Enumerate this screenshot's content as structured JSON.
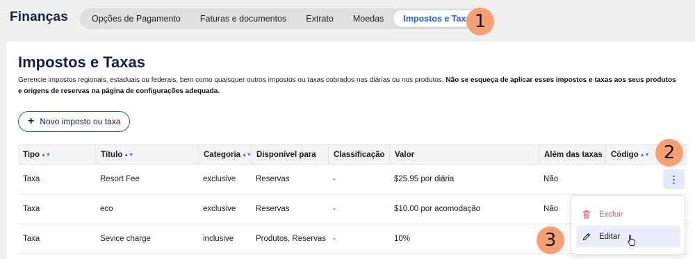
{
  "app": {
    "title": "Finanças"
  },
  "tabs": [
    {
      "label": "Opções de Pagamento",
      "active": false
    },
    {
      "label": "Faturas e documentos",
      "active": false
    },
    {
      "label": "Extrato",
      "active": false
    },
    {
      "label": "Moedas",
      "active": false
    },
    {
      "label": "Impostos e Taxas",
      "active": true
    }
  ],
  "callouts": {
    "one": "1",
    "two": "2",
    "three": "3"
  },
  "page": {
    "title": "Impostos e Taxas",
    "description": "Gerencie impostos regionais, estaduais ou federais, bem como quaisquer outros impostos ou taxas cobrados nas diárias ou nos produtos.",
    "description_bold": "Não se esqueça de aplicar esses impostos e taxas aos seus produtos e origens de reservas na página de configurações adequada.",
    "new_button": "Novo imposto ou taxa"
  },
  "table": {
    "columns": [
      {
        "label": "Tipo",
        "sortable": true
      },
      {
        "label": "Título",
        "sortable": true
      },
      {
        "label": "Categoria",
        "sortable": true
      },
      {
        "label": "Disponível para",
        "sortable": false
      },
      {
        "label": "Classificação",
        "sortable": false
      },
      {
        "label": "Valor",
        "sortable": false
      },
      {
        "label": "Além das taxas",
        "sortable": false
      },
      {
        "label": "Código",
        "sortable": true
      }
    ],
    "rows": [
      [
        "Taxa",
        "Resort Fee",
        "exclusive",
        "Reservas",
        "-",
        "$25.95 por diária",
        "Não",
        ""
      ],
      [
        "Taxa",
        "eco",
        "exclusive",
        "Reservas",
        "-",
        "$10.00 por acomodação",
        "Não",
        ""
      ],
      [
        "Taxa",
        "Sevice charge",
        "inclusive",
        "Produtos, Reservas",
        "-",
        "10%",
        "",
        ""
      ]
    ]
  },
  "menu": {
    "delete_label": "Excluir",
    "edit_label": "Editar"
  },
  "colors": {
    "accent": "#2563c9",
    "callout": "#f8a071",
    "danger": "#e35d6a",
    "navy": "#142043"
  }
}
